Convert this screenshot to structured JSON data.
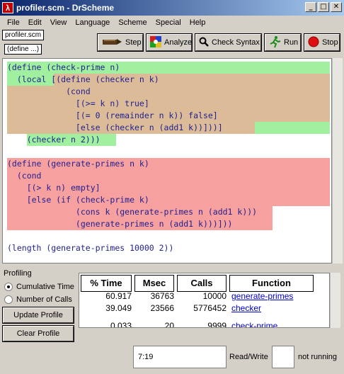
{
  "window": {
    "title": "profiler.scm - DrScheme",
    "minimize": "_",
    "maximize": "□",
    "close": "✕"
  },
  "menu": [
    "File",
    "Edit",
    "View",
    "Language",
    "Scheme",
    "Special",
    "Help"
  ],
  "toolbar": {
    "file_tag": "profiler.scm",
    "define_tag": "(define ...)",
    "step": "Step",
    "analyze": "Analyze",
    "check_syntax": "Check Syntax",
    "run": "Run",
    "stop": "Stop"
  },
  "editor": {
    "lines": [
      "(define (check-prime n)",
      "  (local [(define (checker n k)",
      "            (cond",
      "              [(>= k n) true]",
      "              [(= 0 (remainder n k)) false]",
      "              [else (checker n (add1 k))]))]",
      "    (checker n 2)))",
      "",
      "(define (generate-primes n k)",
      "  (cond",
      "    [(> k n) empty]",
      "    [else (if (check-prime k)",
      "              (cons k (generate-primes n (add1 k)))",
      "              (generate-primes n (add1 k)))]))",
      "",
      "(length (generate-primes 10000 2))"
    ],
    "highlight_colors": {
      "hot": "#f7a0a0",
      "warm": "#dcbc98",
      "cool": "#a0f0a0"
    }
  },
  "profiling": {
    "label": "Profiling",
    "options": [
      "Cumulative Time",
      "Number of Calls"
    ],
    "selected": "Cumulative Time",
    "update_button": "Update Profile",
    "clear_button": "Clear Profile"
  },
  "profile_table": {
    "headers": [
      "% Time",
      "Msec",
      "Calls",
      "Function"
    ],
    "rows": [
      {
        "time": "60.917",
        "msec": "36763",
        "calls": "10000",
        "function": "generate-primes"
      },
      {
        "time": "39.049",
        "msec": "23566",
        "calls": "5776452",
        "function": "checker"
      },
      {
        "time": "0.033",
        "msec": "20",
        "calls": "9999",
        "function": "check-prime"
      }
    ]
  },
  "status": {
    "position": "7:19",
    "mode": "Read/Write",
    "state": "not running"
  }
}
